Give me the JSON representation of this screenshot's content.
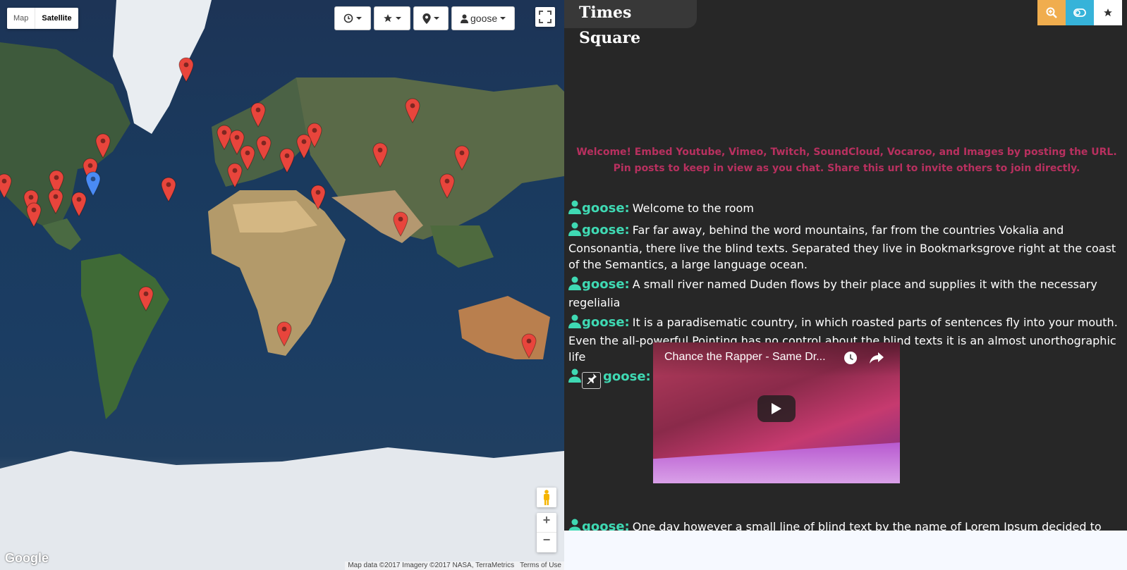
{
  "map": {
    "type_options": [
      "Map",
      "Satellite"
    ],
    "toolbar": {
      "user_label": "goose"
    },
    "attribution": "Map data ©2017 Imagery ©2017 NASA, TerraMetrics",
    "terms": "Terms of Use",
    "logo": "Google",
    "zoom_in": "+",
    "zoom_out": "−"
  },
  "room": {
    "title": "Times Square"
  },
  "welcome": "Welcome! Embed Youtube, Vimeo, Twitch, SoundCloud, Vocaroo, and Images by posting the URL. Pin posts to keep in view as you chat. Share this url to invite others to join directly.",
  "messages": [
    {
      "user": "goose:",
      "text": "Welcome to the room"
    },
    {
      "user": "goose:",
      "text": "Far far away, behind the word mountains, far from the countries Vokalia and Consonantia, there live the blind texts. Separated they live in Bookmarksgrove right at the coast of the Semantics, a large language ocean."
    },
    {
      "user": "goose:",
      "text": "A small river named Duden flows by their place and supplies it with the necessary regelialia"
    },
    {
      "user": "goose:",
      "text": "It is a paradisematic country, in which roasted parts of sentences fly into your mouth. Even the all-powerful Pointing has no control about the blind texts it is an almost unorthographic life"
    },
    {
      "user": "goose:",
      "video_title": "Chance the Rapper - Same Dr..."
    },
    {
      "user": "goose:",
      "text": "One day however a small line of blind text by the name of Lorem Ipsum decided to leave for the far World of Grammar."
    }
  ],
  "colors": {
    "username": "#3fd9b3",
    "welcome": "#b8305f",
    "marker": "#e8453c",
    "marker_self": "#4a8bf5"
  }
}
